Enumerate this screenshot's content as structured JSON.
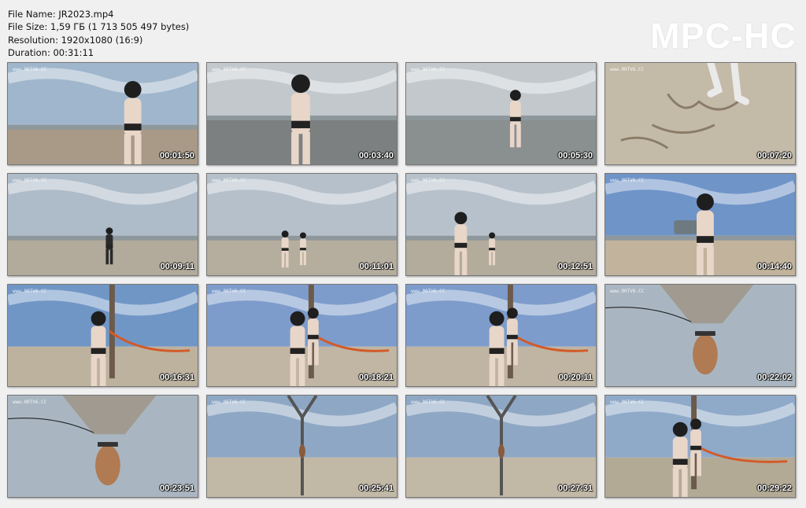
{
  "file_info": {
    "name": "File Name: JR2023.mp4",
    "size": "File Size: 1,59 ГБ (1 713 505 497 bytes)",
    "resolution": "Resolution: 1920x1080 (16:9)",
    "duration": "Duration: 00:31:11"
  },
  "logo": "MPC-HC",
  "watermark": "www.00TV6.CC",
  "thumbnails": [
    {
      "time": "00:01:50",
      "scene": "beach-standing",
      "sky": "#9fb6cc",
      "ground": "#a89a86"
    },
    {
      "time": "00:03:40",
      "scene": "water-closeup",
      "sky": "#c3c8cd",
      "ground": "#7c8080"
    },
    {
      "time": "00:05:30",
      "scene": "water-standing",
      "sky": "#c2c8cc",
      "ground": "#8a8f90"
    },
    {
      "time": "00:07:20",
      "scene": "sand-closeup",
      "sky": "#c8c0b2",
      "ground": "#c4baa8"
    },
    {
      "time": "00:09:11",
      "scene": "beach-far",
      "sky": "#aebbc8",
      "ground": "#b2aa9a"
    },
    {
      "time": "00:11:01",
      "scene": "beach-two",
      "sky": "#b5c0ca",
      "ground": "#b5ad9d"
    },
    {
      "time": "00:12:51",
      "scene": "beach-crouch",
      "sky": "#b6c1cb",
      "ground": "#b3ab9b"
    },
    {
      "time": "00:14:40",
      "scene": "beach-car",
      "sky": "#6f94c8",
      "ground": "#c2b39c"
    },
    {
      "time": "00:16:31",
      "scene": "pole-man",
      "sky": "#7096c6",
      "ground": "#bdb29e"
    },
    {
      "time": "00:18:21",
      "scene": "pole-climb",
      "sky": "#7d9ccb",
      "ground": "#c0b6a3"
    },
    {
      "time": "00:20:11",
      "scene": "pole-climb",
      "sky": "#7d9ccb",
      "ground": "#bfb5a2"
    },
    {
      "time": "00:22:02",
      "scene": "upward",
      "sky": "#a9b6c2",
      "ground": "#a09a90"
    },
    {
      "time": "00:23:51",
      "scene": "upward",
      "sky": "#a9b6c2",
      "ground": "#a09a90"
    },
    {
      "time": "00:25:41",
      "scene": "pole-y",
      "sky": "#8ea7c4",
      "ground": "#c2b8a6"
    },
    {
      "time": "00:27:31",
      "scene": "pole-y",
      "sky": "#8ea7c4",
      "ground": "#c2b8a6"
    },
    {
      "time": "00:29:22",
      "scene": "pole-side",
      "sky": "#8fa9c9",
      "ground": "#b3aa96"
    }
  ]
}
